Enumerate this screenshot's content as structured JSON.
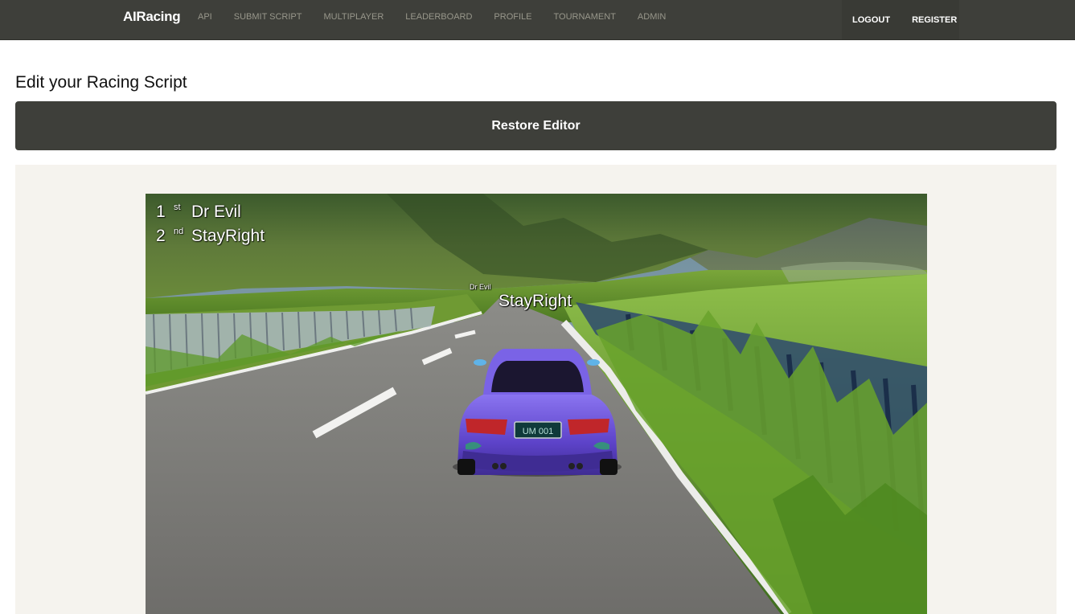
{
  "navbar": {
    "brand": "AIRacing",
    "left_items": [
      {
        "label": "API"
      },
      {
        "label": "SUBMIT SCRIPT"
      },
      {
        "label": "MULTIPLAYER"
      },
      {
        "label": "LEADERBOARD"
      },
      {
        "label": "PROFILE"
      },
      {
        "label": "TOURNAMENT"
      },
      {
        "label": "ADMIN"
      }
    ],
    "right_items": [
      {
        "label": "LOGOUT"
      },
      {
        "label": "REGISTER"
      }
    ]
  },
  "main": {
    "heading": "Edit your Racing Script",
    "restore_button": "Restore Editor"
  },
  "game": {
    "standings": [
      {
        "position": "1",
        "suffix": "st",
        "name": "Dr Evil"
      },
      {
        "position": "2",
        "suffix": "nd",
        "name": "StayRight"
      }
    ],
    "car_labels": {
      "far_car": "Dr Evil",
      "player_car": "StayRight"
    },
    "license_plate": "UM 001"
  },
  "colors": {
    "navbar_bg": "#3e3f3a",
    "nav_link": "#98978b",
    "well_bg": "#f5f3ee",
    "car_body": "#6b4fd8"
  }
}
